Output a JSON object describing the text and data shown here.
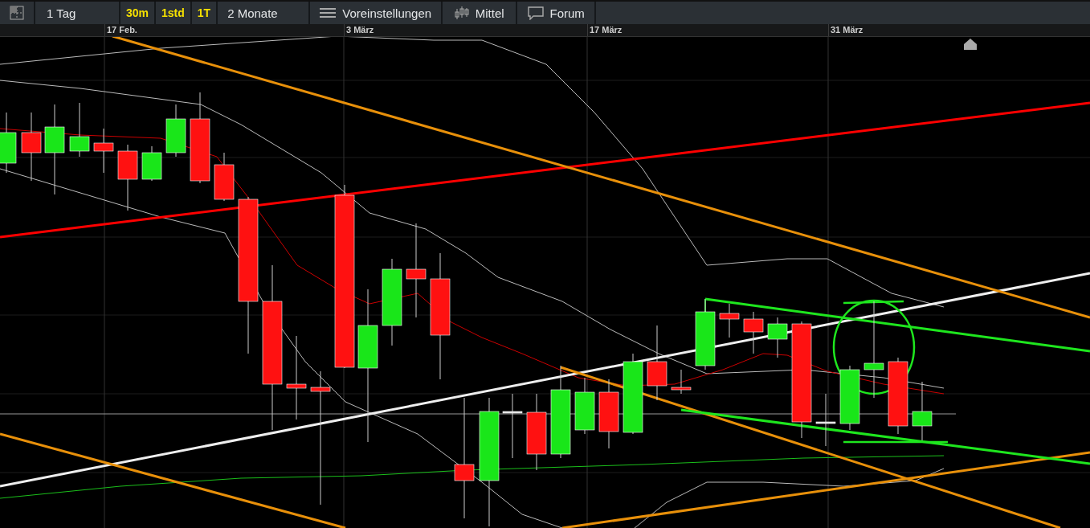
{
  "toolbar": {
    "period": "1 Tag",
    "intervals": [
      "30m",
      "1std",
      "1T"
    ],
    "range": "2 Monate",
    "settings": "Voreinstellungen",
    "chart_type": "Mittel",
    "forum": "Forum"
  },
  "x_axis": {
    "labels": [
      "17 Feb.",
      "3 März",
      "17 März",
      "31 März"
    ]
  }
}
